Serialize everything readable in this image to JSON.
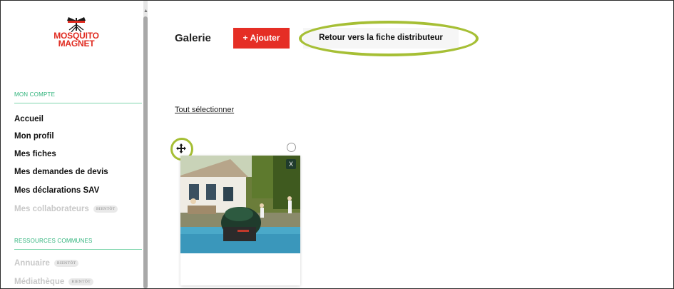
{
  "brand": {
    "logo_line1": "MOSQUITO",
    "logo_line2": "MAGNET",
    "accent": "#e52e25",
    "green": "#2fb37b",
    "highlight": "#a6bf35"
  },
  "sidebar": {
    "section1_title": "MON COMPTE",
    "items": [
      {
        "label": "Accueil"
      },
      {
        "label": "Mon profil"
      },
      {
        "label": "Mes fiches"
      },
      {
        "label": "Mes demandes de devis"
      },
      {
        "label": "Mes déclarations SAV"
      },
      {
        "label": "Mes collaborateurs",
        "badge": "BIENTÔT"
      }
    ],
    "section2_title": "RESSOURCES COMMUNES",
    "items2": [
      {
        "label": "Annuaire",
        "badge": "BIENTÔT"
      },
      {
        "label": "Médiathèque",
        "badge": "BIENTÔT"
      }
    ]
  },
  "main": {
    "title": "Galerie",
    "add_label": "+ Ajouter",
    "back_label": "Retour vers la fiche distributeur",
    "select_all": "Tout sélectionner"
  },
  "gallery": {
    "card": {
      "close_label": "X"
    }
  }
}
